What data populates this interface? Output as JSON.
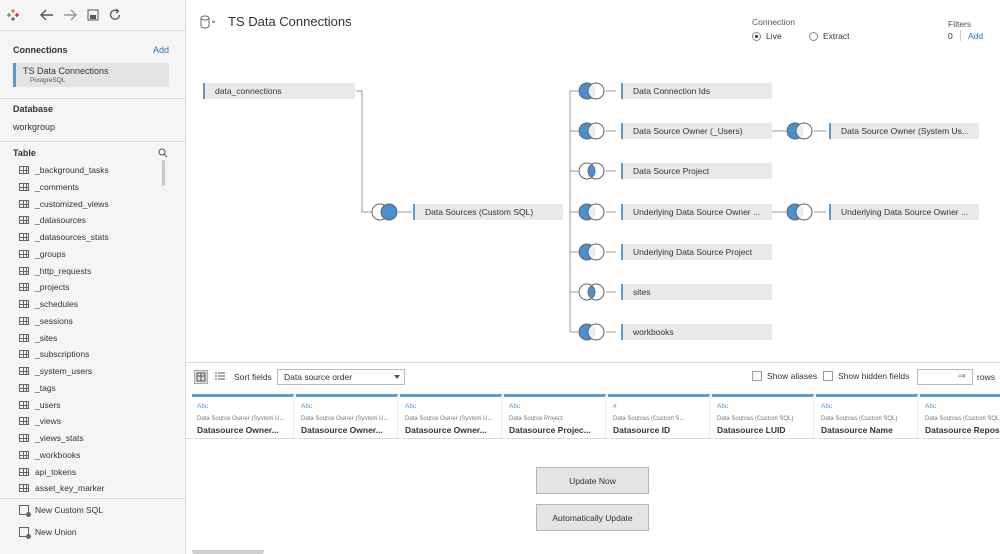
{
  "header": {
    "title": "TS Data Connections",
    "connection_label": "Connection",
    "live_label": "Live",
    "extract_label": "Extract",
    "filters_label": "Filters",
    "filters_count": "0",
    "filters_add": "Add"
  },
  "sidebar": {
    "connections_title": "Connections",
    "add_label": "Add",
    "connection_name": "TS Data Connections",
    "connection_type": "PostgreSQL",
    "database_title": "Database",
    "database_value": "workgroup",
    "table_title": "Table",
    "tables": [
      "_background_tasks",
      "_comments",
      "_customized_views",
      "_datasources",
      "_datasources_stats",
      "_groups",
      "_http_requests",
      "_projects",
      "_schedules",
      "_sessions",
      "_sites",
      "_subscriptions",
      "_system_users",
      "_tags",
      "_users",
      "_views",
      "_views_stats",
      "_workbooks",
      "api_tokens",
      "asset_key_marker"
    ],
    "new_custom_sql": "New Custom SQL",
    "new_union": "New Union"
  },
  "canvas": {
    "root_table": "data_connections",
    "mid_table": "Data Sources (Custom SQL)",
    "right_tables": [
      "Data Connection Ids",
      "Data Source Owner (_Users)",
      "Data Source Project",
      "Underlying Data Source Owner ...",
      "Underlying Data Source Project",
      "sites",
      "workbooks"
    ],
    "far_tables": [
      "Data Source Owner (System Us...",
      "Underlying Data Source Owner ..."
    ]
  },
  "grid": {
    "sort_label": "Sort fields",
    "sort_value": "Data source order",
    "show_aliases": "Show aliases",
    "show_hidden": "Show hidden fields",
    "rows_label": "rows",
    "columns": [
      {
        "type": "Abc",
        "source": "Data Source Owner (System U...",
        "name": "Datasource Owner..."
      },
      {
        "type": "Abc",
        "source": "Data Source Owner (System U...",
        "name": "Datasource Owner..."
      },
      {
        "type": "Abc",
        "source": "Data Source Owner (System U...",
        "name": "Datasource Owner..."
      },
      {
        "type": "Abc",
        "source": "Data Source Project",
        "name": "Datasource Projec..."
      },
      {
        "type": "#",
        "source": "Data Sources (Custom S...",
        "name": "Datasource ID"
      },
      {
        "type": "Abc",
        "source": "Data Sources (Custom SQL)",
        "name": "Datasource LUID"
      },
      {
        "type": "Abc",
        "source": "Data Sources (Custom SQL)",
        "name": "Datasource Name"
      },
      {
        "type": "Abc",
        "source": "Data Sources (Custom SQL)",
        "name": "Datasource Reposi..."
      }
    ],
    "update_now": "Update Now",
    "auto_update": "Automatically Update"
  },
  "colors": {
    "accent": "#5b9bd5",
    "link": "#1f77b4",
    "join_fill": "#4a8fd0"
  }
}
